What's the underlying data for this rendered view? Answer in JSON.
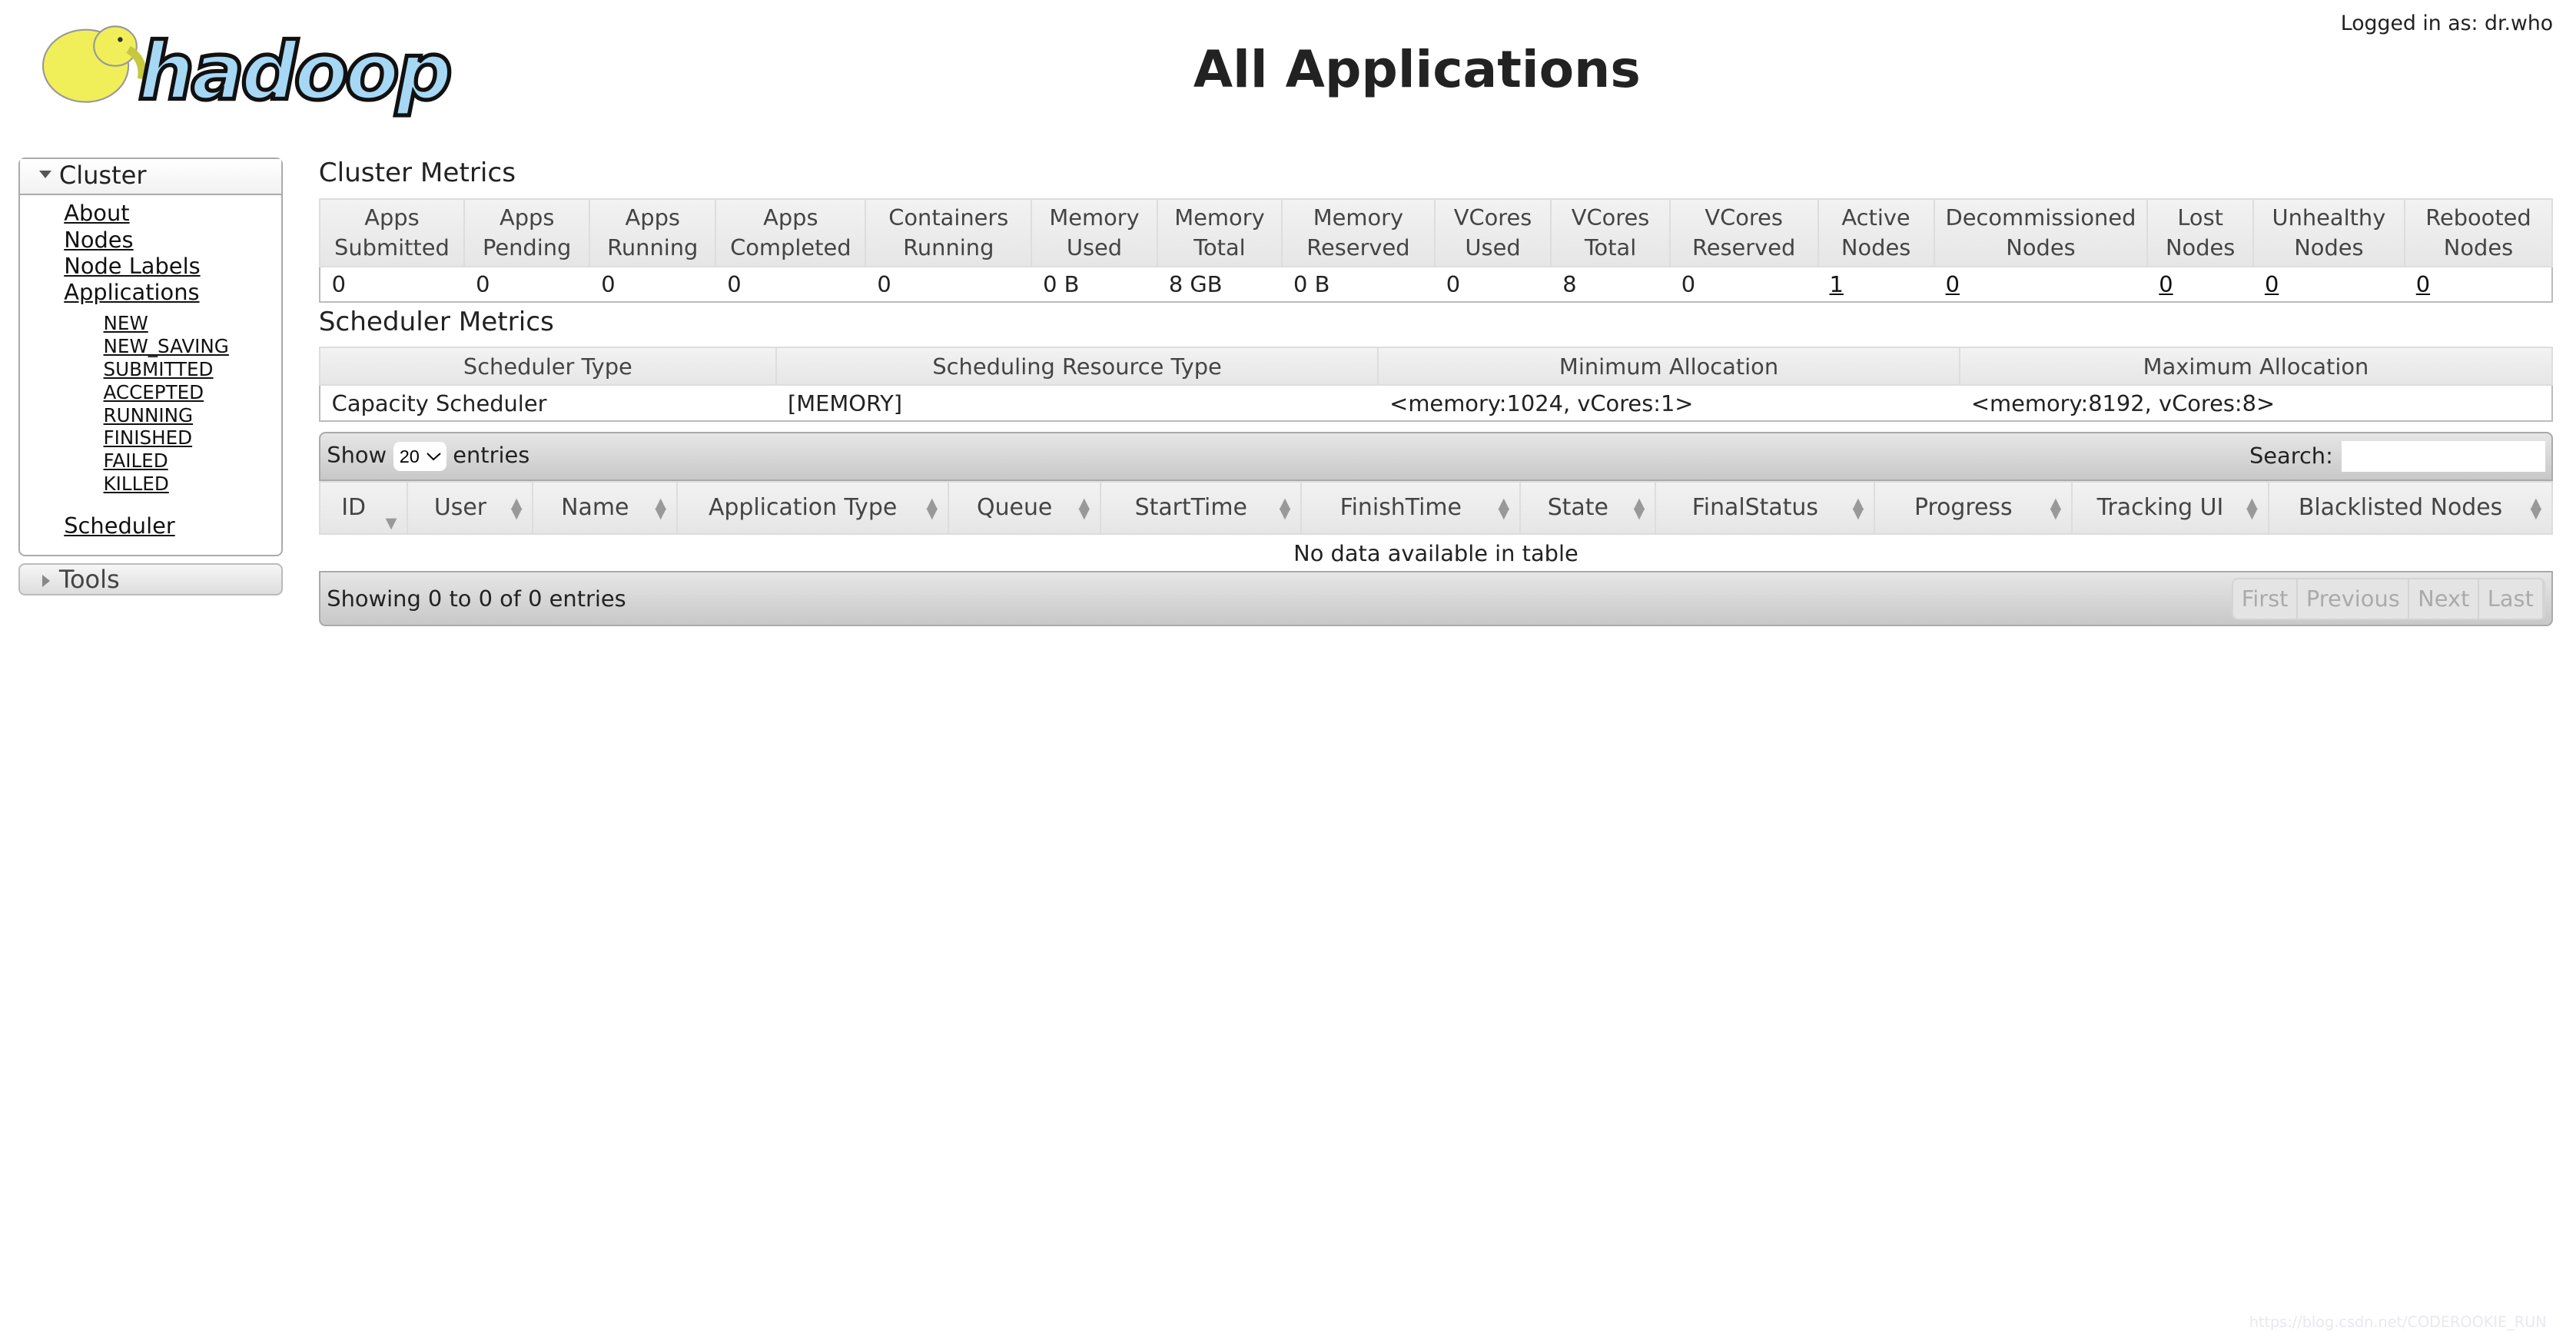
{
  "header": {
    "logo_text": "hadoop",
    "title": "All Applications",
    "login_text": "Logged in as: dr.who"
  },
  "sidebar": {
    "cluster_label": "Cluster",
    "links": [
      "About",
      "Nodes",
      "Node Labels",
      "Applications"
    ],
    "app_states": [
      "NEW",
      "NEW_SAVING",
      "SUBMITTED",
      "ACCEPTED",
      "RUNNING",
      "FINISHED",
      "FAILED",
      "KILLED"
    ],
    "scheduler": "Scheduler",
    "tools_label": "Tools"
  },
  "cluster_metrics": {
    "title": "Cluster Metrics",
    "columns": [
      {
        "h1": "Apps",
        "h2": "Submitted",
        "v": "0"
      },
      {
        "h1": "Apps",
        "h2": "Pending",
        "v": "0"
      },
      {
        "h1": "Apps",
        "h2": "Running",
        "v": "0"
      },
      {
        "h1": "Apps",
        "h2": "Completed",
        "v": "0"
      },
      {
        "h1": "Containers",
        "h2": "Running",
        "v": "0"
      },
      {
        "h1": "Memory",
        "h2": "Used",
        "v": "0 B"
      },
      {
        "h1": "Memory",
        "h2": "Total",
        "v": "8 GB"
      },
      {
        "h1": "Memory",
        "h2": "Reserved",
        "v": "0 B"
      },
      {
        "h1": "VCores",
        "h2": "Used",
        "v": "0"
      },
      {
        "h1": "VCores",
        "h2": "Total",
        "v": "8"
      },
      {
        "h1": "VCores",
        "h2": "Reserved",
        "v": "0"
      },
      {
        "h1": "Active",
        "h2": "Nodes",
        "v": "1",
        "link": true
      },
      {
        "h1": "Decommissioned",
        "h2": "Nodes",
        "v": "0",
        "link": true
      },
      {
        "h1": "Lost",
        "h2": "Nodes",
        "v": "0",
        "link": true
      },
      {
        "h1": "Unhealthy",
        "h2": "Nodes",
        "v": "0",
        "link": true
      },
      {
        "h1": "Rebooted",
        "h2": "Nodes",
        "v": "0",
        "link": true
      }
    ]
  },
  "scheduler_metrics": {
    "title": "Scheduler Metrics",
    "headers": [
      "Scheduler Type",
      "Scheduling Resource Type",
      "Minimum Allocation",
      "Maximum Allocation"
    ],
    "row": [
      "Capacity Scheduler",
      "[MEMORY]",
      "<memory:1024, vCores:1>",
      "<memory:8192, vCores:8>"
    ]
  },
  "apps_table": {
    "show_label": "Show",
    "entries_label": "entries",
    "page_size": "20",
    "search_label": "Search:",
    "search_value": "",
    "columns": [
      "ID",
      "User",
      "Name",
      "Application Type",
      "Queue",
      "StartTime",
      "FinishTime",
      "State",
      "FinalStatus",
      "Progress",
      "Tracking UI",
      "Blacklisted Nodes"
    ],
    "empty_text": "No data available in table",
    "info": "Showing 0 to 0 of 0 entries",
    "pager": [
      "First",
      "Previous",
      "Next",
      "Last"
    ]
  },
  "watermark": "https://blog.csdn.net/CODEROOKIE_RUN"
}
